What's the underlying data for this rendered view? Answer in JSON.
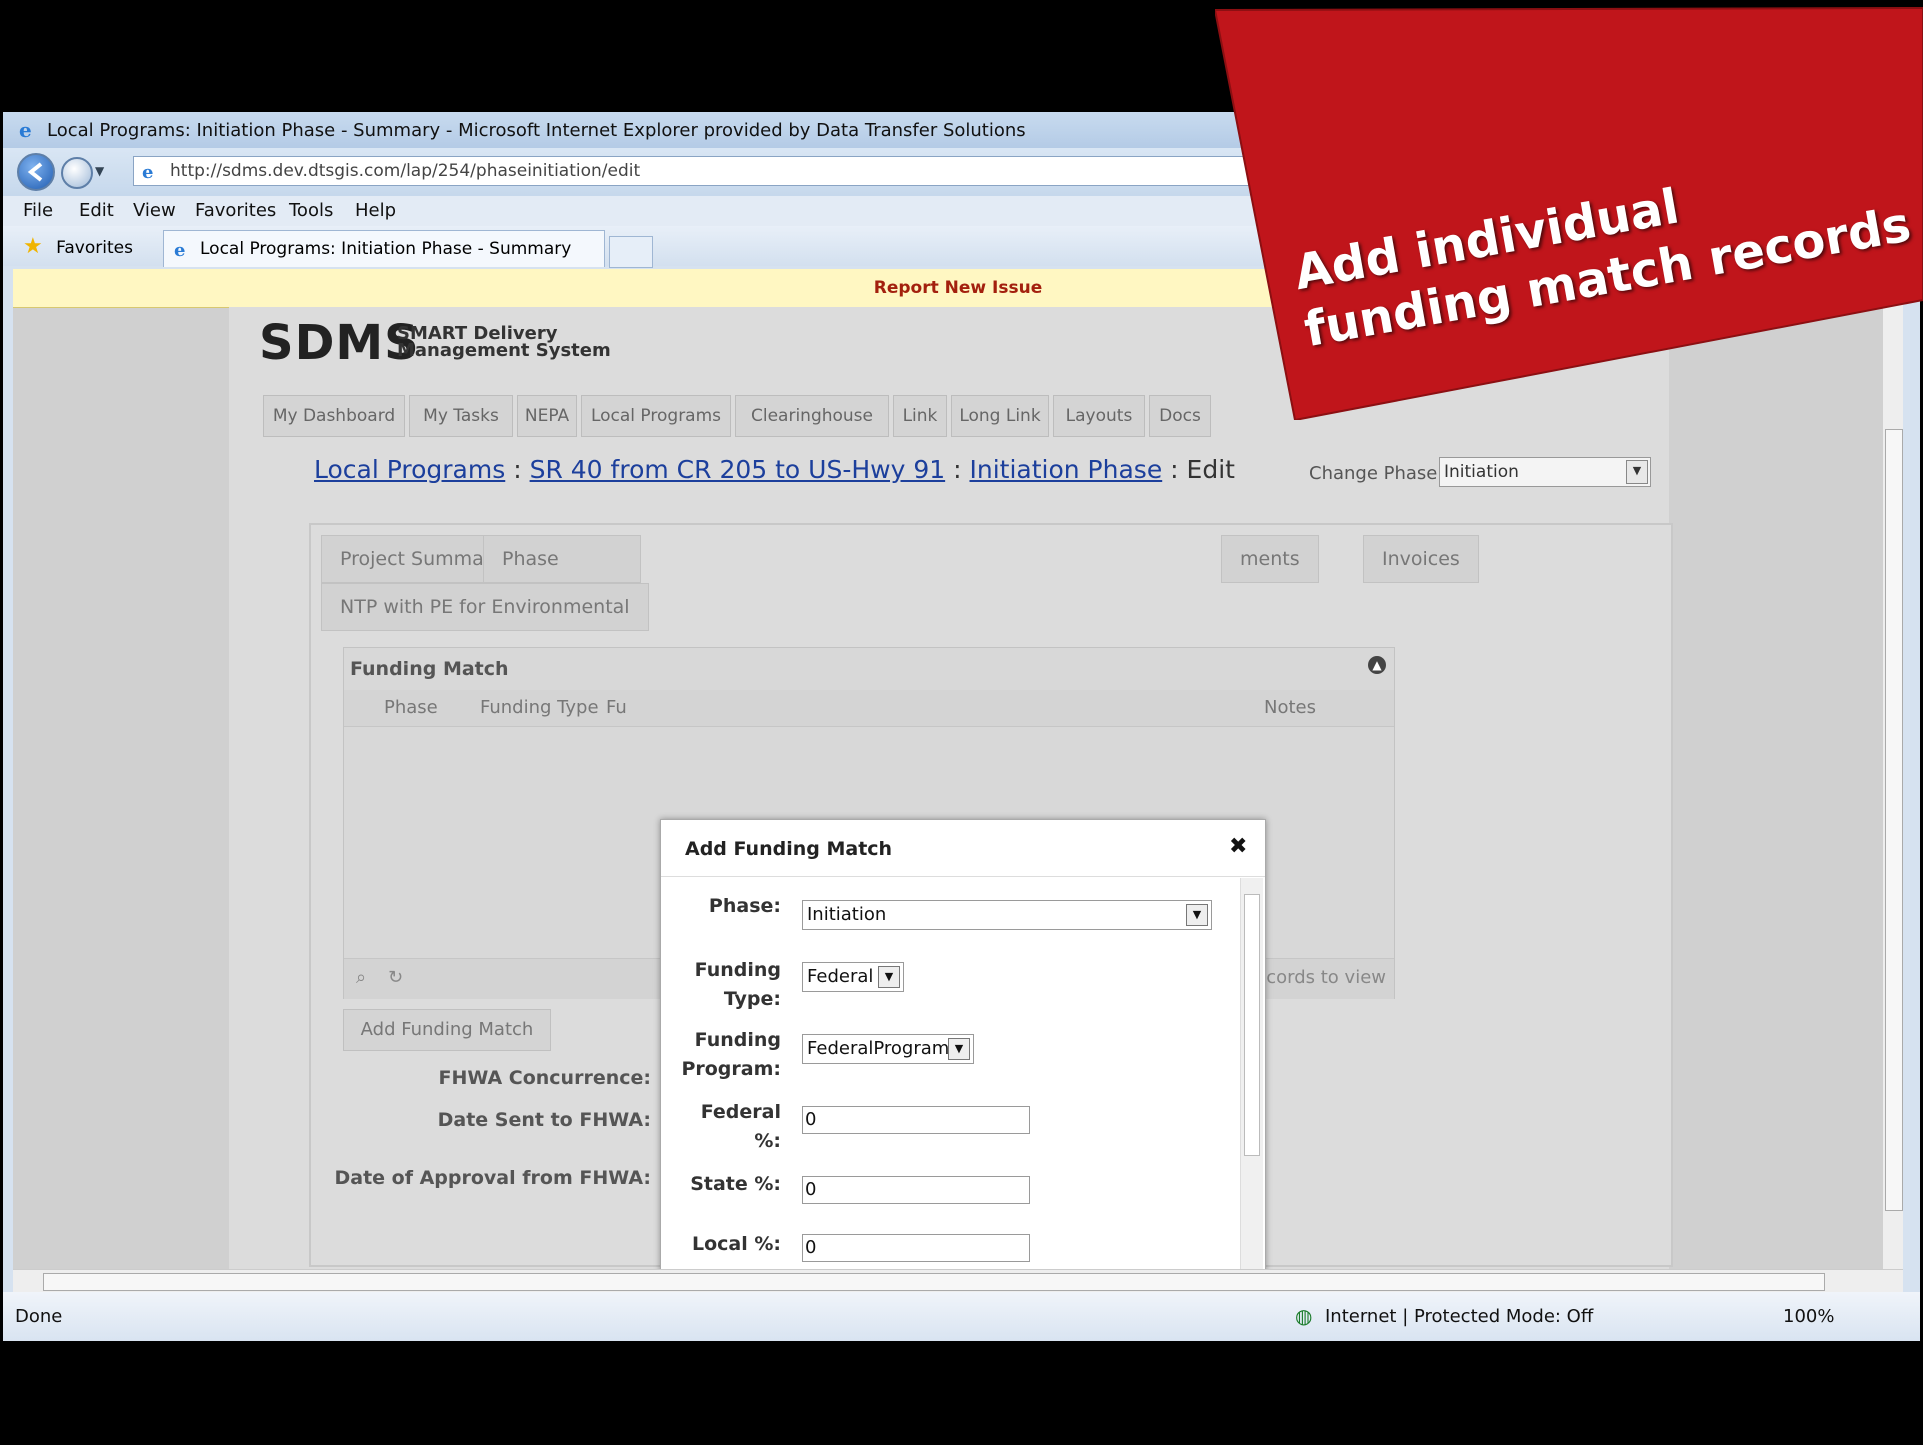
{
  "browser": {
    "title": "Local Programs: Initiation Phase - Summary - Microsoft Internet Explorer provided by Data Transfer Solutions",
    "url": "http://sdms.dev.dtsgis.com/lap/254/phaseinitiation/edit",
    "menu": [
      "File",
      "Edit",
      "View",
      "Favorites",
      "Tools",
      "Help"
    ],
    "favorites_label": "Favorites",
    "tab_label": "Local Programs: Initiation Phase - Summary",
    "status_done": "Done",
    "status_zone": "Internet | Protected Mode: Off",
    "zoom": "100%"
  },
  "report_issue": "Report New Issue",
  "logo": {
    "main": "SDMS",
    "sub1": "SMART Delivery",
    "sub2": "Management System"
  },
  "nav_tabs": [
    "My Dashboard",
    "My Tasks",
    "NEPA",
    "Local Programs",
    "Clearinghouse",
    "Link",
    "Long Link",
    "Layouts",
    "Docs"
  ],
  "breadcrumb": {
    "part1": "Local Programs",
    "sep1": ":",
    "part2": "SR 40 from CR 205 to US-Hwy 91",
    "sep2": ":",
    "part3": "Initiation Phase",
    "part4": ": Edit"
  },
  "change_phase": {
    "label": "Change Phase:",
    "value": "Initiation"
  },
  "sub_tabs": {
    "project_summary": "Project Summary",
    "phase_summary": "Phase Summ",
    "attachments": "ments",
    "invoices": "Invoices",
    "ntp": "NTP with PE for Environmental"
  },
  "grid": {
    "title": "Funding Match",
    "columns": {
      "phase": "Phase",
      "funding_type": "Funding Type",
      "fu": "Fu",
      "notes": "Notes"
    },
    "footer": "ecords to view"
  },
  "add_funding_match_button": "Add Funding Match",
  "form": {
    "fhwa_concurrence": "FHWA Concurrence:",
    "date_sent": "Date Sent to FHWA:",
    "date_approval": "Date of Approval from FHWA:"
  },
  "modal": {
    "title": "Add Funding Match",
    "close": "✖",
    "phase_label": "Phase:",
    "phase_value": "Initiation",
    "funding_type_label1": "Funding",
    "funding_type_label2": "Type:",
    "funding_type_value": "Federal",
    "funding_program_label1": "Funding",
    "funding_program_label2": "Program:",
    "funding_program_value": "FederalProgram",
    "federal_label1": "Federal",
    "federal_label2": "%:",
    "federal_value": "0",
    "state_label": "State %:",
    "state_value": "0",
    "local_label": "Local %:",
    "local_value": "0"
  },
  "banner": {
    "line1": "Add individual",
    "line2": "funding match records",
    "color": "#c0151b"
  }
}
